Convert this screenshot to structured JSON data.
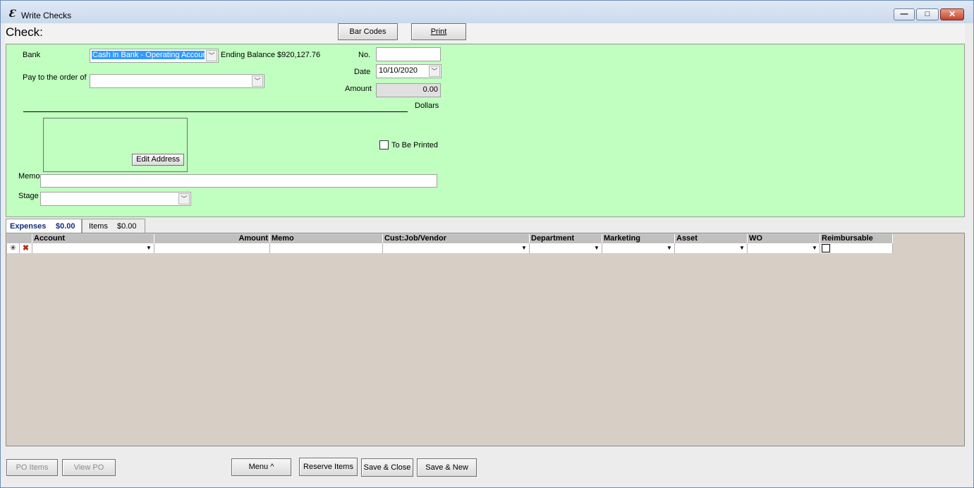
{
  "window": {
    "title": "Write Checks",
    "app_icon": "e-logo-icon",
    "minimize_glyph": "—",
    "maximize_glyph": "□",
    "close_glyph": "✕"
  },
  "header": {
    "title": "Check:",
    "bar_codes_label": "Bar Codes",
    "print_label": "Print"
  },
  "form": {
    "bank_label": "Bank",
    "bank_value": "Cash in Bank - Operating Account",
    "ending_balance_label": "Ending Balance",
    "ending_balance_value": "$920,127.76",
    "pay_to_label": "Pay to the order of",
    "pay_to_value": "",
    "no_label": "No.",
    "no_value": "",
    "date_label": "Date",
    "date_value": "10/10/2020",
    "amount_label": "Amount",
    "amount_value": "0.00",
    "dollars_label": "Dollars",
    "edit_address_label": "Edit Address",
    "to_be_printed_label": "To Be Printed",
    "to_be_printed_checked": false,
    "memo_label": "Memo",
    "memo_value": "",
    "stage_label": "Stage",
    "stage_value": ""
  },
  "tabs": [
    {
      "label": "Expenses",
      "amount": "$0.00",
      "active": true
    },
    {
      "label": "Items",
      "amount": "$0.00",
      "active": false
    }
  ],
  "grid": {
    "columns": [
      "Account",
      "Amount",
      "Memo",
      "Cust:Job/Vendor",
      "Department",
      "Marketing",
      "Asset",
      "WO",
      "Reimbursable"
    ],
    "new_row_marker": "✳"
  },
  "footer": {
    "po_items_label": "PO Items",
    "view_po_label": "View PO",
    "menu_label": "Menu ^",
    "reserve_items_label": "Reserve Items",
    "save_close_label": "Save & Close",
    "save_new_label": "Save & New"
  },
  "colors": {
    "form_background": "#c0ffc0",
    "grid_background": "#d7cfc6",
    "active_tab_text": "#0f2e7a",
    "selection": "#3399ff"
  }
}
